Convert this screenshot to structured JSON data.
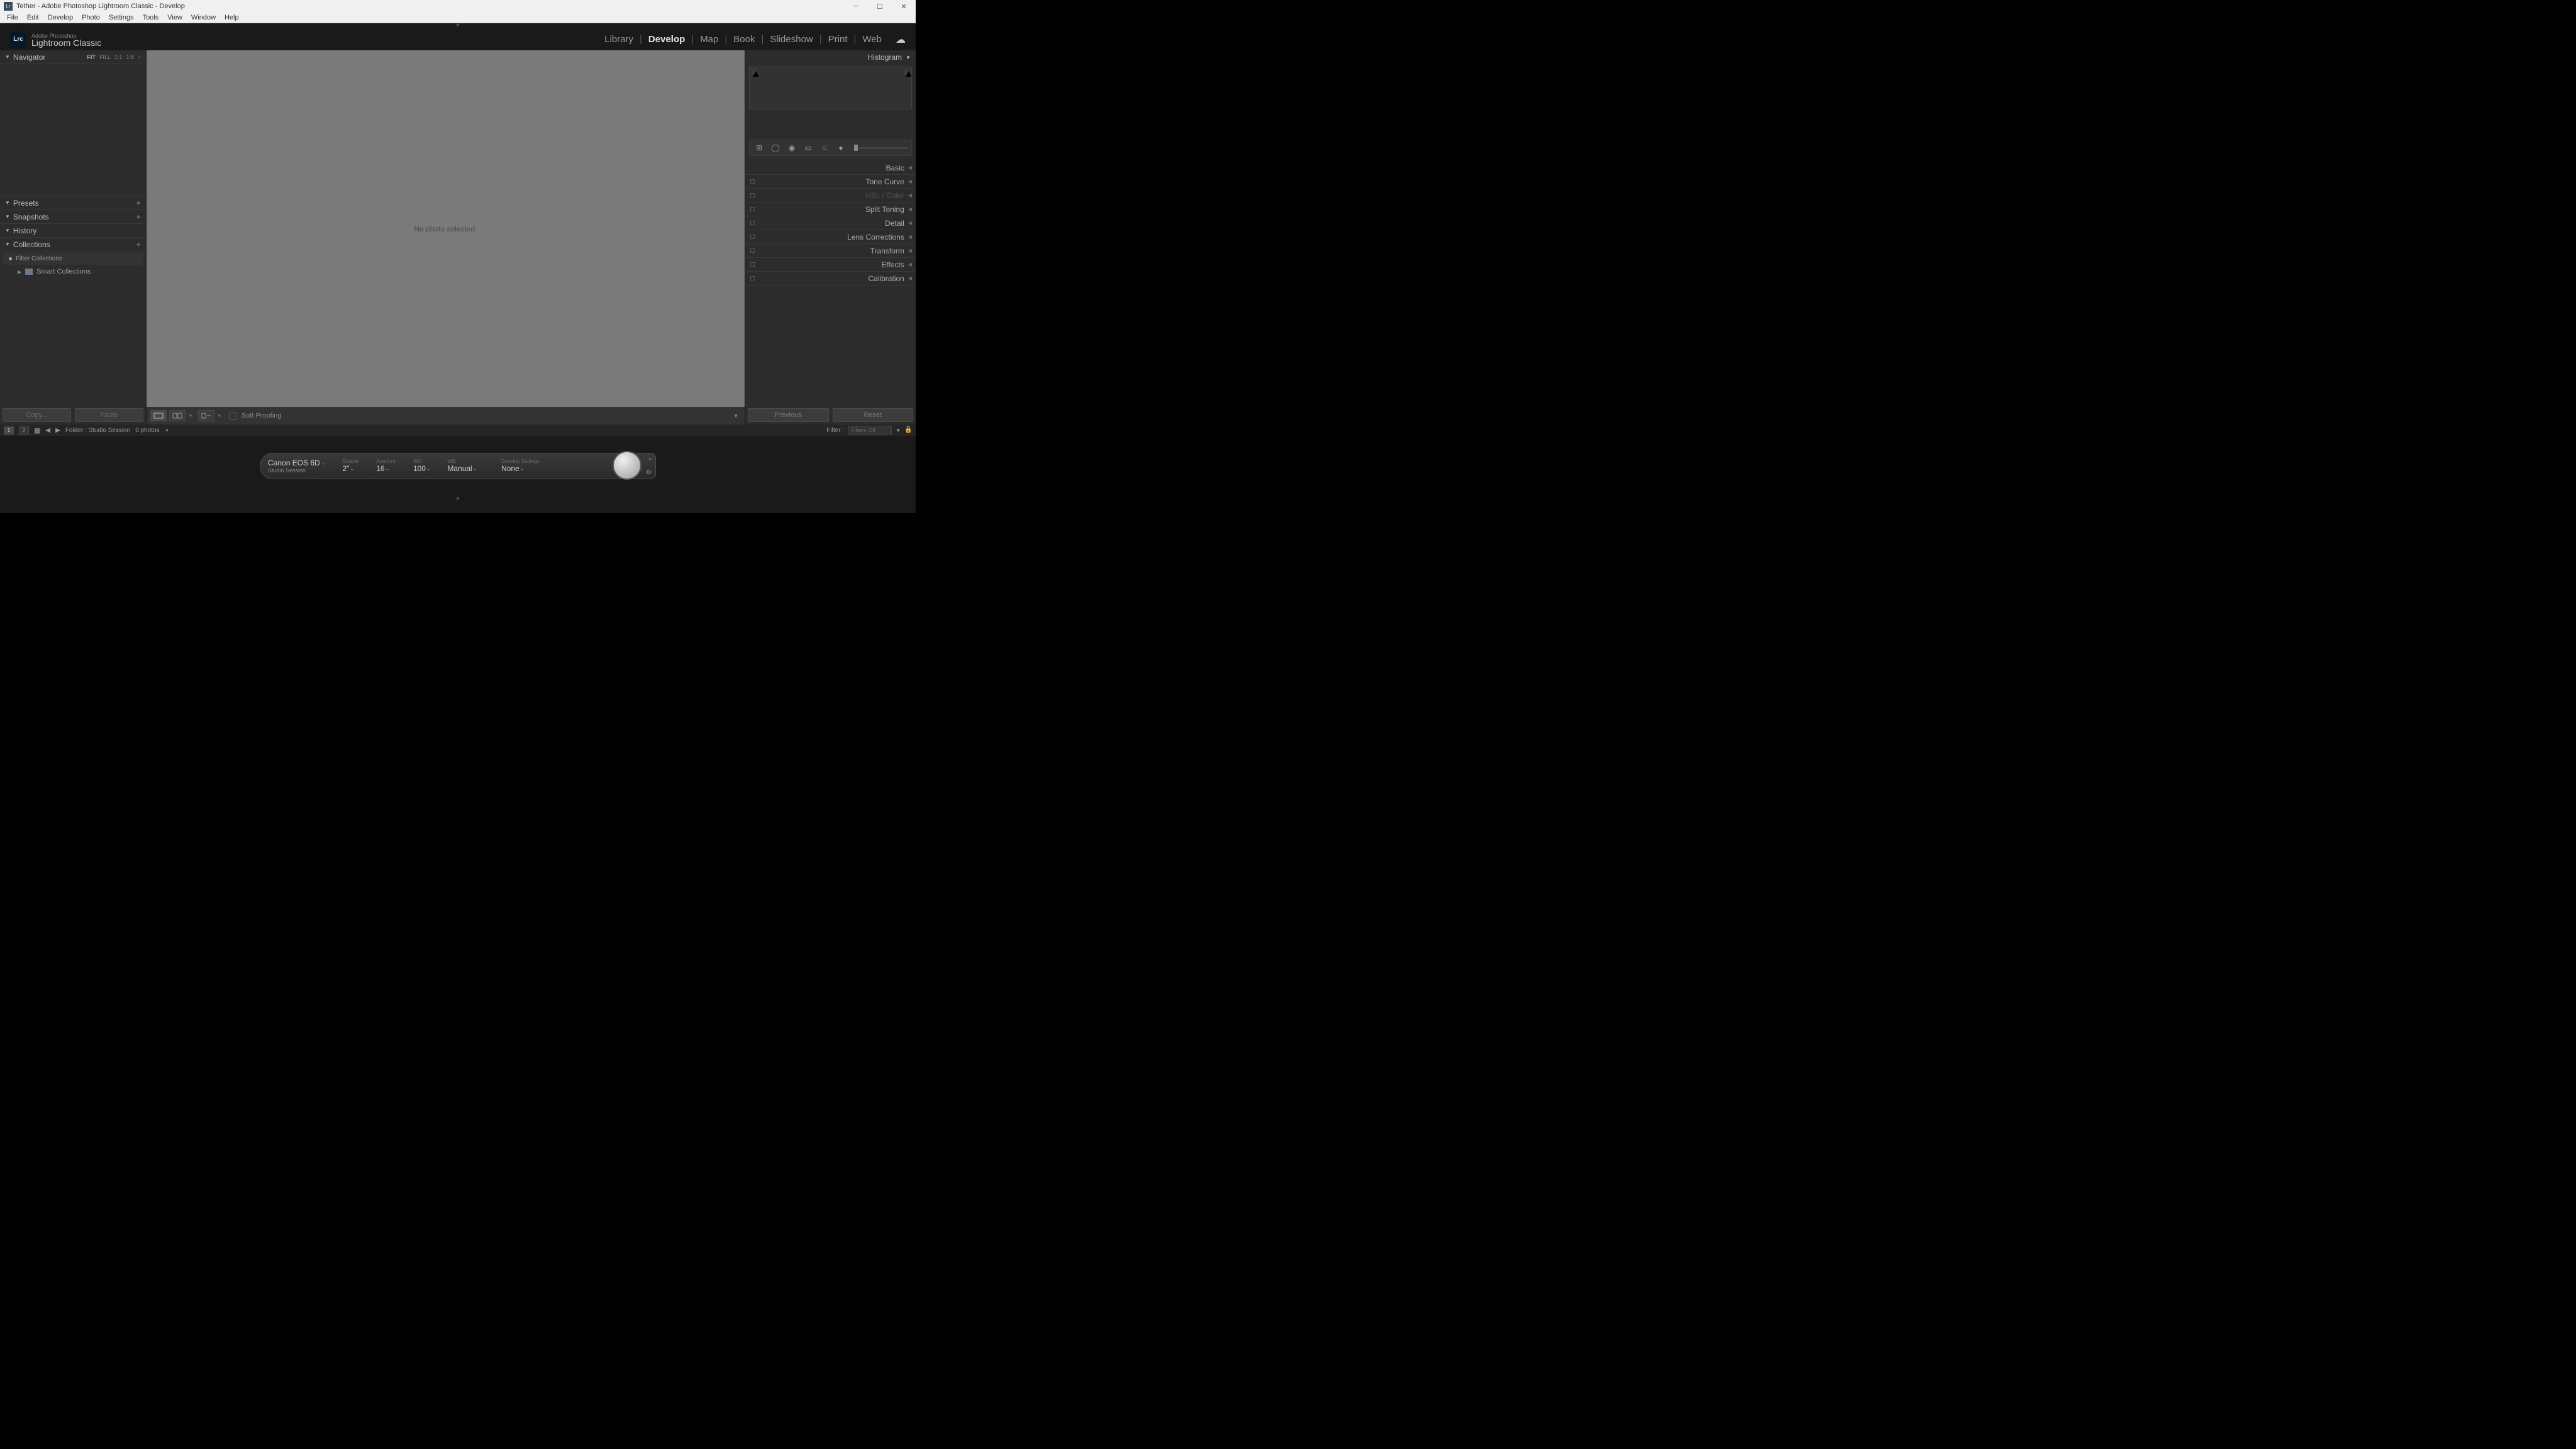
{
  "window": {
    "title": "Tether - Adobe Photoshop Lightroom Classic - Develop",
    "icon_text": "Lr"
  },
  "menu": [
    "File",
    "Edit",
    "Develop",
    "Photo",
    "Settings",
    "Tools",
    "View",
    "Window",
    "Help"
  ],
  "identity": {
    "top": "Adobe Photoshop",
    "main": "Lightroom Classic",
    "logo": "Lrc"
  },
  "modules": [
    "Library",
    "Develop",
    "Map",
    "Book",
    "Slideshow",
    "Print",
    "Web"
  ],
  "active_module": "Develop",
  "left": {
    "navigator": {
      "label": "Navigator",
      "zoom": [
        "FIT",
        "FILL",
        "1:1",
        "1:8"
      ],
      "active_zoom": "FIT"
    },
    "presets": "Presets",
    "snapshots": "Snapshots",
    "history": "History",
    "collections": {
      "label": "Collections",
      "filter_placeholder": "Filter Collections",
      "smart": "Smart Collections"
    },
    "copy": "Copy...",
    "paste": "Paste"
  },
  "center": {
    "empty_msg": "No photo selected.",
    "soft_proofing": "Soft Proofing"
  },
  "right": {
    "histogram": "Histogram",
    "panels": [
      {
        "label": "Basic",
        "dim": false,
        "switch": false
      },
      {
        "label": "Tone Curve",
        "dim": false,
        "switch": true
      },
      {
        "label": "HSL / Color",
        "dim": true,
        "switch": true
      },
      {
        "label": "Split Toning",
        "dim": false,
        "switch": true
      },
      {
        "label": "Detail",
        "dim": false,
        "switch": true
      },
      {
        "label": "Lens Corrections",
        "dim": false,
        "switch": true
      },
      {
        "label": "Transform",
        "dim": false,
        "switch": true
      },
      {
        "label": "Effects",
        "dim": false,
        "switch": true
      },
      {
        "label": "Calibration",
        "dim": false,
        "switch": true
      }
    ],
    "previous": "Previous",
    "reset": "Reset"
  },
  "filmstrip": {
    "path": "Folder : Studio Session",
    "count": "0 photos",
    "filter_label": "Filter :",
    "filter_value": "Filters Off"
  },
  "tether": {
    "camera": "Canon EOS 6D",
    "session": "Studio Session",
    "shutter_label": "Shutter",
    "shutter": "2\"",
    "aperture_label": "Aperture",
    "aperture": "16",
    "iso_label": "ISO",
    "iso": "100",
    "wb_label": "WB",
    "wb": "Manual",
    "dev_label": "Develop Settings",
    "dev": "None"
  }
}
